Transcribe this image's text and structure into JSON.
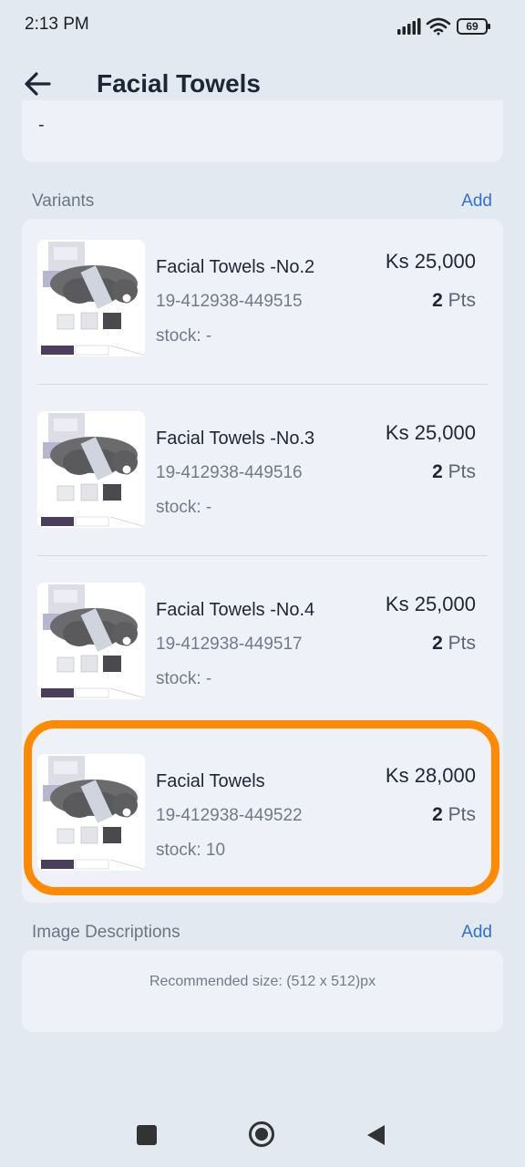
{
  "status_bar": {
    "time": "2:13 PM",
    "battery": "69"
  },
  "header": {
    "title": "Facial Towels"
  },
  "top_card": {
    "value": "-"
  },
  "variants_section": {
    "label": "Variants",
    "add_label": "Add"
  },
  "variants": [
    {
      "name": "Facial Towels -No.2",
      "code": "19-412938-449515",
      "stock": "stock: -",
      "price": "Ks 25,000",
      "pts_value": "2",
      "pts_unit": "Pts"
    },
    {
      "name": "Facial Towels -No.3",
      "code": "19-412938-449516",
      "stock": "stock: -",
      "price": "Ks 25,000",
      "pts_value": "2",
      "pts_unit": "Pts"
    },
    {
      "name": "Facial Towels -No.4",
      "code": "19-412938-449517",
      "stock": "stock: -",
      "price": "Ks 25,000",
      "pts_value": "2",
      "pts_unit": "Pts"
    },
    {
      "name": "Facial Towels",
      "code": "19-412938-449522",
      "stock": "stock: 10",
      "price": "Ks 28,000",
      "pts_value": "2",
      "pts_unit": "Pts"
    }
  ],
  "image_descriptions": {
    "label": "Image Descriptions",
    "add_label": "Add",
    "recommended": "Recommended size: (512 x 512)px"
  },
  "colors": {
    "background": "#e3e9f1",
    "card": "#eef2f8",
    "accent_link": "#2f6fd6",
    "highlight": "#ff8a00"
  }
}
